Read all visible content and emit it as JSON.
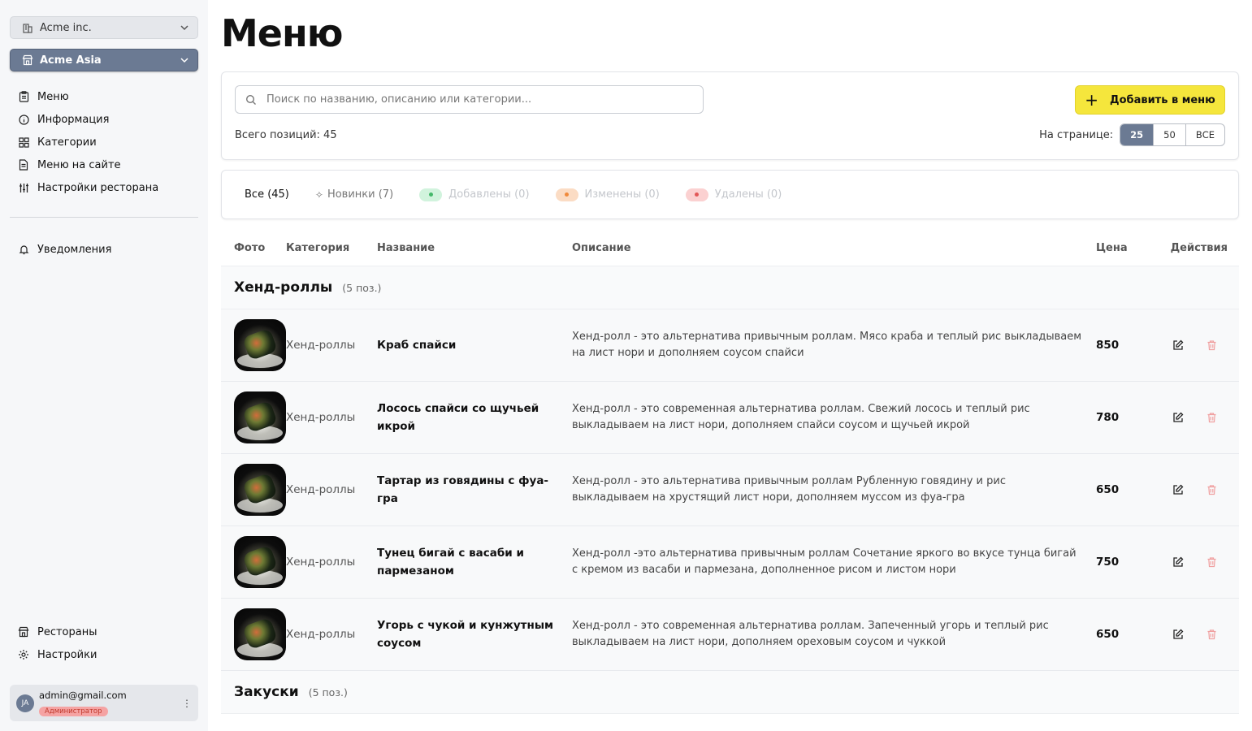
{
  "sidebar": {
    "orgs": [
      {
        "label": "Acme inc.",
        "icon": "building-icon"
      },
      {
        "label": "Acme Asia",
        "icon": "store-icon"
      }
    ],
    "nav_main": [
      {
        "label": "Меню",
        "icon": "clipboard-icon"
      },
      {
        "label": "Информация",
        "icon": "info-icon"
      },
      {
        "label": "Категории",
        "icon": "grid-icon"
      },
      {
        "label": "Меню на сайте",
        "icon": "document-icon"
      },
      {
        "label": "Настройки ресторана",
        "icon": "sliders-icon"
      }
    ],
    "nav_notif": [
      {
        "label": "Уведомления",
        "icon": "bell-icon"
      }
    ],
    "nav_bottom": [
      {
        "label": "Рестораны",
        "icon": "store-icon"
      },
      {
        "label": "Настройки",
        "icon": "gear-icon"
      }
    ],
    "user": {
      "initials": "JA",
      "email": "admin@gmail.com",
      "role": "Администратор"
    }
  },
  "page": {
    "title": "Меню"
  },
  "toolbar": {
    "search_placeholder": "Поиск по названию, описанию или категории...",
    "add_label": "Добавить в меню",
    "total": "Всего позиций: 45",
    "per_page_label": "На странице:",
    "per_page_options": [
      "25",
      "50",
      "ВСЕ"
    ],
    "per_page_selected": "25"
  },
  "filters": {
    "all": "Все (45)",
    "new": "Новинки (7)",
    "added": "Добавлены (0)",
    "changed": "Изменены (0)",
    "deleted": "Удалены (0)"
  },
  "table": {
    "headers": {
      "photo": "Фото",
      "category": "Категория",
      "name": "Название",
      "description": "Описание",
      "price": "Цена",
      "actions": "Действия"
    },
    "groups": [
      {
        "name": "Хенд-роллы",
        "count": "(5 поз.)",
        "rows": [
          {
            "category": "Хенд-роллы",
            "name": "Краб спайси",
            "description": "Хенд-ролл - это альтернатива привычным роллам. Мясо краба и теплый рис выкладываем на лист нори и дополняем соусом спайси",
            "price": "850"
          },
          {
            "category": "Хенд-роллы",
            "name": "Лосось спайси со щучьей икрой",
            "description": "Хенд-ролл - это современная альтернатива роллам. Свежий лосось и теплый рис выкладываем на лист нори, дополняем спайси соусом и щучьей икрой",
            "price": "780"
          },
          {
            "category": "Хенд-роллы",
            "name": "Тартар из говядины с фуа-гра",
            "description": "Хенд-ролл - это альтернатива привычным роллам Рубленную говядину и рис выкладываем на хрустящий лист нори, дополняем муссом из фуа-гра",
            "price": "650"
          },
          {
            "category": "Хенд-роллы",
            "name": "Тунец бигай с васаби и пармезаном",
            "description": "Хенд-ролл -это альтернатива привычным роллам Сочетание яркого во вкусе тунца бигай с кремом из васаби и пармезана, дополненное рисом и листом нори",
            "price": "750"
          },
          {
            "category": "Хенд-роллы",
            "name": "Угорь с чукой и кунжутным соусом",
            "description": "Хенд-ролл - это современная альтернатива роллам. Запеченный угорь и теплый рис выкладываем на лист нори, дополняем ореховым соусом и чуккой",
            "price": "650"
          }
        ]
      },
      {
        "name": "Закуски",
        "count": "(5 поз.)",
        "rows": []
      }
    ]
  }
}
